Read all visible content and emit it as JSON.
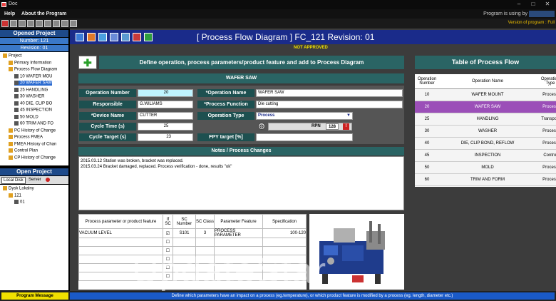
{
  "window": {
    "title": "Doc"
  },
  "menu": {
    "items": [
      "Help",
      "About the Program"
    ],
    "right_text": "Program is using by"
  },
  "toolbar": {
    "version_text": "Version of program : Full"
  },
  "opened_project": {
    "header": "Opened Project",
    "number": "Number: 121",
    "revision": "Revision: 01",
    "tree": [
      {
        "label": "Project",
        "level": 0
      },
      {
        "label": "Primary Information",
        "level": 1
      },
      {
        "label": "Process Flow Diagram",
        "level": 1
      },
      {
        "label": "10 WAFER MOU",
        "level": 2
      },
      {
        "label": "20 WAFER SAW",
        "level": 2,
        "selected": true
      },
      {
        "label": "25 HANDLING",
        "level": 2
      },
      {
        "label": "30 WASHER",
        "level": 2
      },
      {
        "label": "40 DIE, CLIP BO",
        "level": 2
      },
      {
        "label": "45 INSPECTION",
        "level": 2
      },
      {
        "label": "50 MOLD",
        "level": 2
      },
      {
        "label": "60 TRIM AND FO",
        "level": 2
      },
      {
        "label": "PC History of Change",
        "level": 1
      },
      {
        "label": "Process FMEA",
        "level": 1
      },
      {
        "label": "FMEA History of Chan",
        "level": 1
      },
      {
        "label": "Control Plan",
        "level": 1
      },
      {
        "label": "CP History of Change",
        "level": 1
      }
    ]
  },
  "open_project": {
    "header": "Open Project",
    "local_disk": "Local Disk",
    "server": "Server",
    "tree": [
      {
        "label": "Dysk Lokalny",
        "level": 0
      },
      {
        "label": "121",
        "level": 1
      },
      {
        "label": "01",
        "level": 2
      }
    ]
  },
  "page": {
    "title": "[ Process Flow Diagram ] FC_121 Revision: 01",
    "not_approved": "NOT APPROVED",
    "define_banner": "Define operation, process parameters/product feature and add to Process Diagram",
    "section_title": "WAFER SAW"
  },
  "form": {
    "operation_number_label": "Operation Number",
    "operation_number": "20",
    "operation_name_label": "*Operation Name",
    "operation_name": "WAFER SAW",
    "responsible_label": "Responsible",
    "responsible": "G.WILIAMS",
    "process_function_label": "*Process Function",
    "process_function": "Die cutting",
    "device_name_label": "*Device Name",
    "device_name": "CUTTER",
    "operation_type_label": "Operation Type",
    "operation_type": "Process",
    "cycle_time_label": "Cycle Time (s)",
    "cycle_time": "25",
    "rpn_label": "RPN",
    "rpn": "128",
    "cycle_target_label": "Cycle Target (s)",
    "cycle_target": "23",
    "fpy_label": "FPY target [%]",
    "fpy": ""
  },
  "notes": {
    "header": "Notes / Process Changes",
    "lines": [
      "2015.03.12 Station was broken, bracket was replaced.",
      "2015.03.24 Bracket damaged, replaced. Process verification - done, results \"ok\""
    ]
  },
  "params_table": {
    "headers": [
      "Process parameter or product feature",
      "If SC",
      "SC Number",
      "SC Class",
      "Parameter Feature",
      "Specification"
    ],
    "rows": [
      [
        "VACUUM LEVEL",
        "",
        "S101",
        "3",
        "PROCESS PARAMETER",
        "100-120"
      ]
    ]
  },
  "flow_table": {
    "title": "Table of Process Flow",
    "headers": [
      "Operation Number",
      "Operation Name",
      "Operation Type"
    ],
    "rows": [
      [
        "10",
        "WAFER MOUNT",
        "Process"
      ],
      [
        "20",
        "WAFER SAW",
        "Process"
      ],
      [
        "25",
        "HANDLING",
        "Transport"
      ],
      [
        "30",
        "WASHER",
        "Process"
      ],
      [
        "40",
        "DIE, CLIP BOND, REFLOW",
        "Process"
      ],
      [
        "45",
        "INSPECTION",
        "Control"
      ],
      [
        "50",
        "MOLD",
        "Process"
      ],
      [
        "60",
        "TRIM AND FORM",
        "Process"
      ]
    ],
    "selected_index": 1
  },
  "status": {
    "button": "Program Message",
    "message": "Define which parameters have an impact on a process (eg.temperature), or which product feature is modified by a process (eg. length, diameter etc.)"
  },
  "watermark": "UpdateStar",
  "colors": {
    "selected_row": "#9b4fb8",
    "header_blue": "#1a2b8a",
    "teal": "#2a6464",
    "warning": "#f0e000"
  }
}
